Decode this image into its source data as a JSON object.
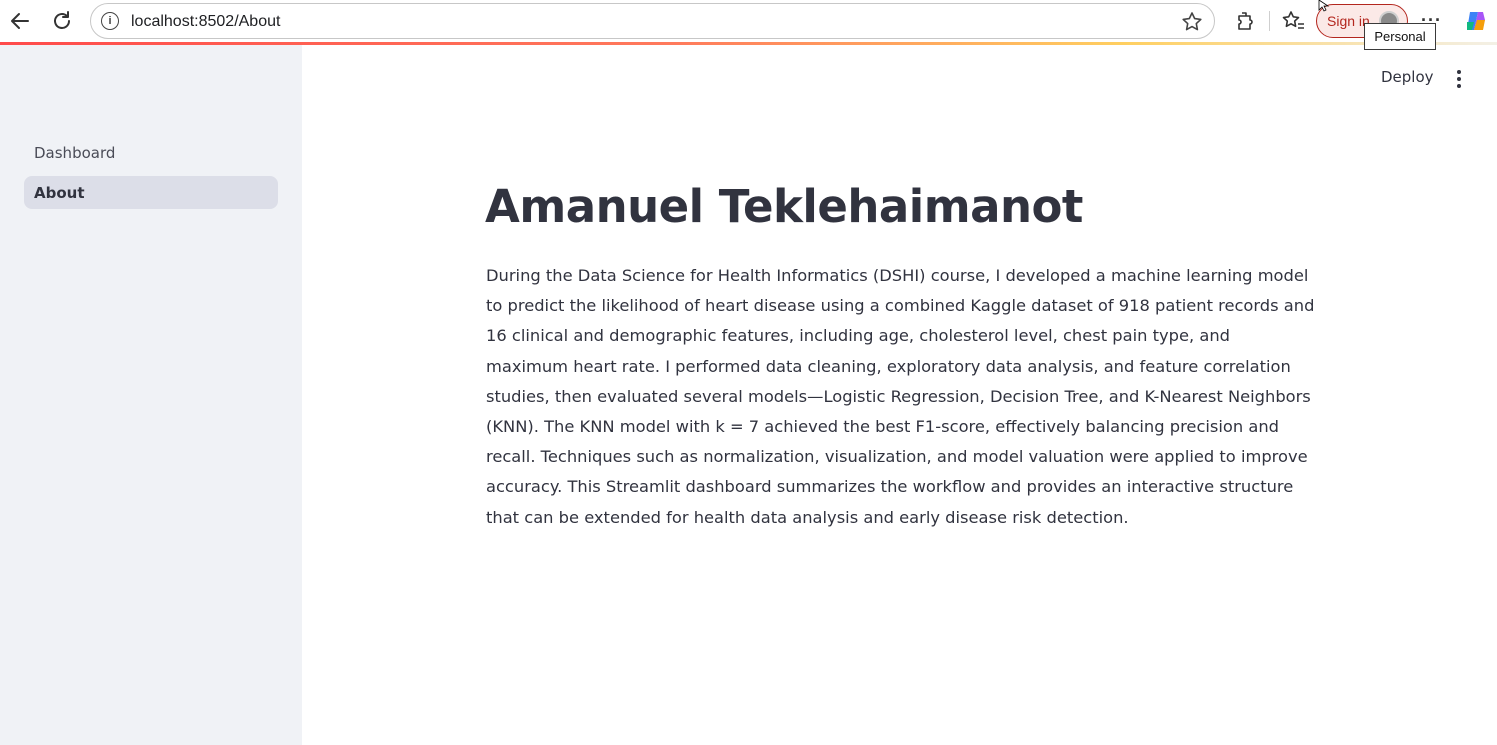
{
  "browser": {
    "url": "localhost:8502/About",
    "signin_label": "Sign in",
    "tooltip": "Personal",
    "more_label": "···"
  },
  "sidebar": {
    "items": [
      {
        "label": "Dashboard",
        "active": false
      },
      {
        "label": "About",
        "active": true
      }
    ]
  },
  "header": {
    "deploy_label": "Deploy"
  },
  "main": {
    "title": "Amanuel Teklehaimanot",
    "paragraph": "During the Data Science for Health Informatics (DSHI) course, I developed a machine learning model to predict the likelihood of heart disease using a combined Kaggle dataset of 918 patient records and 16 clinical and demographic features, including age, cholesterol level, chest pain type, and maximum heart rate. I performed data cleaning, exploratory data analysis, and feature correlation studies, then evaluated several models—Logistic Regression, Decision Tree, and K-Nearest Neighbors (KNN). The KNN model with k = 7 achieved the best F1-score, effectively balancing precision and recall. Techniques such as normalization, visualization, and model valuation were applied to improve accuracy. This Streamlit dashboard summarizes the workflow and provides an interactive structure that can be extended for health data analysis and early disease risk detection."
  },
  "colors": {
    "sidebar_bg": "#f0f2f6",
    "active_item_bg": "#dcdee8",
    "text": "#31333f",
    "signin_accent": "#b3261e"
  },
  "icons": [
    "back-arrow-icon",
    "reload-icon",
    "info-icon",
    "star-icon",
    "extensions-icon",
    "favorites-icon",
    "profile-avatar-icon",
    "more-icon",
    "copilot-icon",
    "kebab-menu-icon"
  ]
}
